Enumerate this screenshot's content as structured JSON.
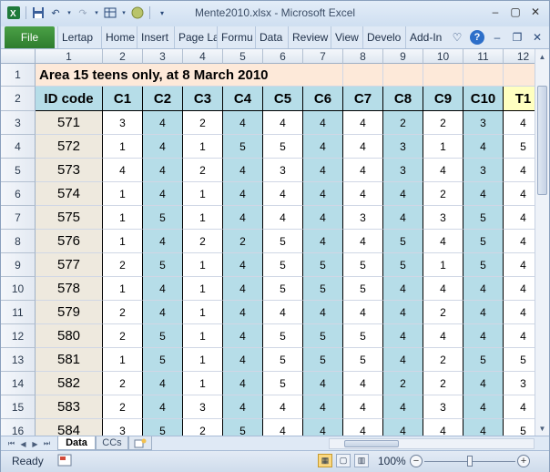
{
  "window": {
    "title": "Mente2010.xlsx  -  Microsoft Excel",
    "qat_icons": [
      "excel-logo-icon",
      "save-icon",
      "undo-icon",
      "redo-icon",
      "layout-icon",
      "circle-icon",
      "qat-dropdown-icon"
    ]
  },
  "ribbon": {
    "file_label": "File",
    "tabs": [
      "Lertap",
      "Home",
      "Insert",
      "Page La",
      "Formu",
      "Data",
      "Review",
      "View",
      "Develo",
      "Add-In"
    ],
    "right_icons": [
      "heart-icon",
      "help-icon",
      "minimize-ribbon-icon",
      "restore-ribbon-icon",
      "close-ribbon-icon"
    ]
  },
  "grid": {
    "column_headers": [
      "1",
      "2",
      "3",
      "4",
      "5",
      "6",
      "7",
      "8",
      "9",
      "10",
      "11",
      "12"
    ],
    "row_headers": [
      "1",
      "2",
      "3",
      "4",
      "5",
      "6",
      "7",
      "8",
      "9",
      "10",
      "11",
      "12",
      "13",
      "14",
      "15",
      "16"
    ],
    "title_text": "Area 15 teens only, at 8 March 2010",
    "header_row": [
      "ID code",
      "C1",
      "C2",
      "C3",
      "C4",
      "C5",
      "C6",
      "C7",
      "C8",
      "C9",
      "C10",
      "T1"
    ],
    "data_rows": [
      [
        "571",
        "3",
        "4",
        "2",
        "4",
        "4",
        "4",
        "4",
        "2",
        "2",
        "3",
        "4"
      ],
      [
        "572",
        "1",
        "4",
        "1",
        "5",
        "5",
        "4",
        "4",
        "3",
        "1",
        "4",
        "5"
      ],
      [
        "573",
        "4",
        "4",
        "2",
        "4",
        "3",
        "4",
        "4",
        "3",
        "4",
        "3",
        "4"
      ],
      [
        "574",
        "1",
        "4",
        "1",
        "4",
        "4",
        "4",
        "4",
        "4",
        "2",
        "4",
        "4"
      ],
      [
        "575",
        "1",
        "5",
        "1",
        "4",
        "4",
        "4",
        "3",
        "4",
        "3",
        "5",
        "4"
      ],
      [
        "576",
        "1",
        "4",
        "2",
        "2",
        "5",
        "4",
        "4",
        "5",
        "4",
        "5",
        "4"
      ],
      [
        "577",
        "2",
        "5",
        "1",
        "4",
        "5",
        "5",
        "5",
        "5",
        "1",
        "5",
        "4"
      ],
      [
        "578",
        "1",
        "4",
        "1",
        "4",
        "5",
        "5",
        "5",
        "4",
        "4",
        "4",
        "4"
      ],
      [
        "579",
        "2",
        "4",
        "1",
        "4",
        "4",
        "4",
        "4",
        "4",
        "2",
        "4",
        "4"
      ],
      [
        "580",
        "2",
        "5",
        "1",
        "4",
        "5",
        "5",
        "5",
        "4",
        "4",
        "4",
        "4"
      ],
      [
        "581",
        "1",
        "5",
        "1",
        "4",
        "5",
        "5",
        "5",
        "4",
        "2",
        "5",
        "5"
      ],
      [
        "582",
        "2",
        "4",
        "1",
        "4",
        "5",
        "4",
        "4",
        "2",
        "2",
        "4",
        "3"
      ],
      [
        "583",
        "2",
        "4",
        "3",
        "4",
        "4",
        "4",
        "4",
        "4",
        "3",
        "4",
        "4"
      ],
      [
        "584",
        "3",
        "5",
        "2",
        "5",
        "4",
        "4",
        "4",
        "4",
        "4",
        "4",
        "5"
      ]
    ]
  },
  "sheet_tabs": [
    "Data",
    "CCs"
  ],
  "new_sheet_icon": "insert-sheet-icon",
  "status": {
    "ready": "Ready",
    "zoom": "100%",
    "zoom_level": 0.5
  },
  "colors": {
    "blue_col": "#b6dde8",
    "id_col": "#eee9de",
    "title_fill": "#fde9d9",
    "file_tab": "#2e7d2e"
  }
}
